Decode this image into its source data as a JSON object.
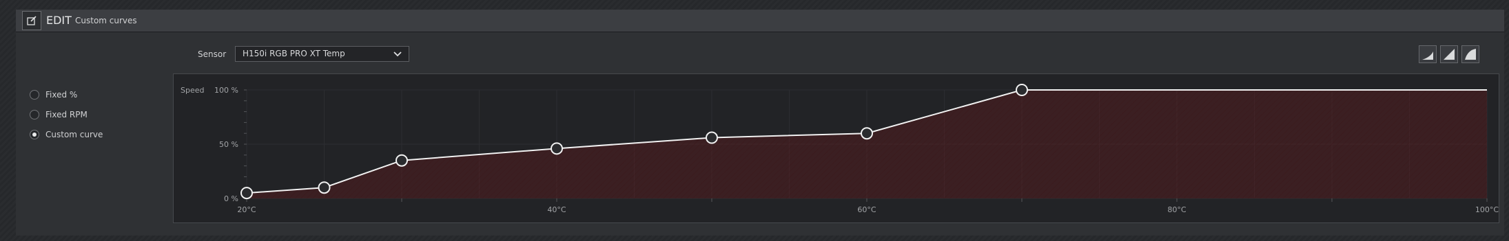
{
  "header": {
    "title": "EDIT",
    "subtitle": "Custom curves"
  },
  "mode_options": [
    {
      "label": "Fixed %",
      "selected": false
    },
    {
      "label": "Fixed RPM",
      "selected": false
    },
    {
      "label": "Custom curve",
      "selected": true
    }
  ],
  "sensor": {
    "label": "Sensor",
    "value": "H150i RGB PRO XT Temp"
  },
  "presets": [
    "quiet-preset-icon",
    "balanced-preset-icon",
    "extreme-preset-icon"
  ],
  "chart_data": {
    "type": "line",
    "ylabel": "Speed",
    "x_ticks": [
      "20°C",
      "40°C",
      "60°C",
      "80°C",
      "100°C"
    ],
    "y_ticks": [
      "100 %",
      "50 %",
      "0 %"
    ],
    "xlim": [
      20,
      100
    ],
    "ylim": [
      0,
      100
    ],
    "points": [
      {
        "x": 20,
        "y": 5
      },
      {
        "x": 25,
        "y": 10
      },
      {
        "x": 30,
        "y": 35
      },
      {
        "x": 40,
        "y": 46
      },
      {
        "x": 50,
        "y": 56
      },
      {
        "x": 60,
        "y": 60
      },
      {
        "x": 70,
        "y": 100
      }
    ],
    "colors": {
      "line": "#f2f2f2",
      "fill": "#5a1a1e",
      "point": "#2a2b2e"
    }
  }
}
